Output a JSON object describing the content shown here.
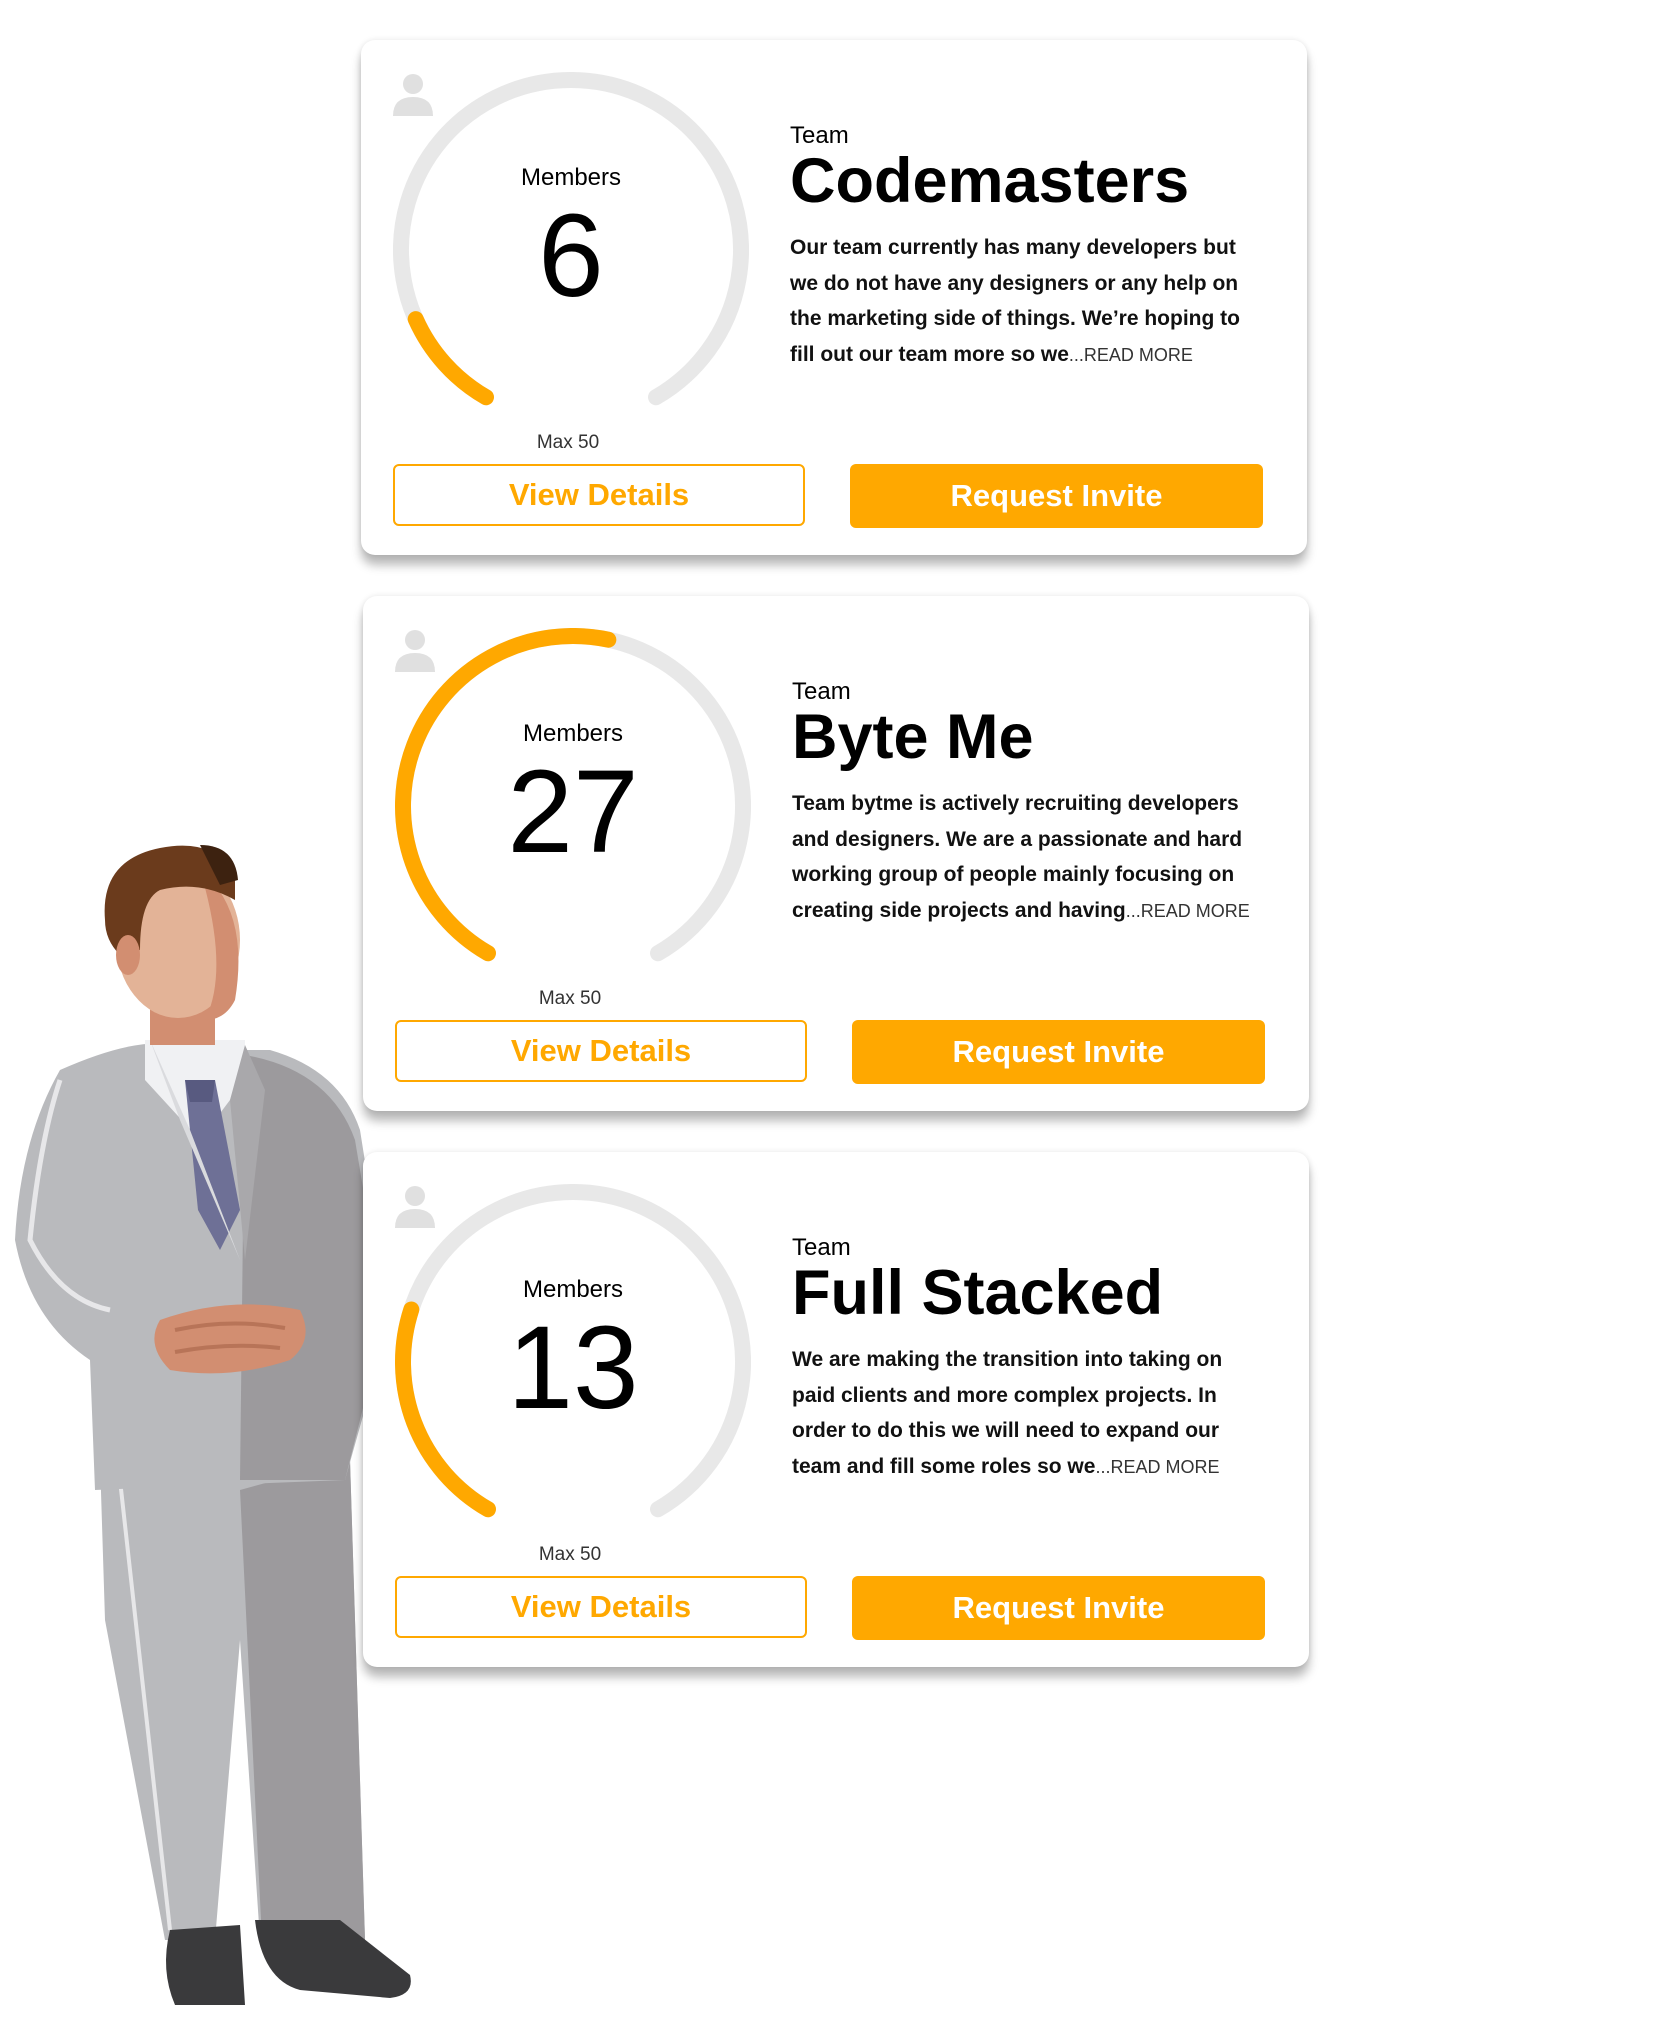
{
  "colors": {
    "accent": "#FFA800",
    "track": "#E8E8E8",
    "icon": "#E0E0E0"
  },
  "teams": [
    {
      "members_label": "Members",
      "members": 6,
      "max_label": "Max 50",
      "max": 50,
      "prefix": "Team",
      "name": "Codemasters",
      "description": "Our team currently has many developers but we do not have any designers or any help on the marketing side of things. We’re hoping to fill out our team more so we",
      "read_more": "...READ MORE",
      "view_label": "View Details",
      "request_label": "Request Invite"
    },
    {
      "members_label": "Members",
      "members": 27,
      "max_label": "Max 50",
      "max": 50,
      "prefix": "Team",
      "name": "Byte Me",
      "description": "Team bytme is actively recruiting developers and designers. We are a passionate and hard working group of people mainly focusing on creating side projects and having",
      "read_more": "...READ MORE",
      "view_label": "View Details",
      "request_label": "Request Invite"
    },
    {
      "members_label": "Members",
      "members": 13,
      "max_label": "Max 50",
      "max": 50,
      "prefix": "Team",
      "name": "Full Stacked",
      "description": "We are making the transition into taking on paid clients and more complex projects. In order to do this we will need to expand our team and fill some roles  so we",
      "read_more": "...READ MORE",
      "view_label": "View Details",
      "request_label": "Request Invite"
    }
  ]
}
